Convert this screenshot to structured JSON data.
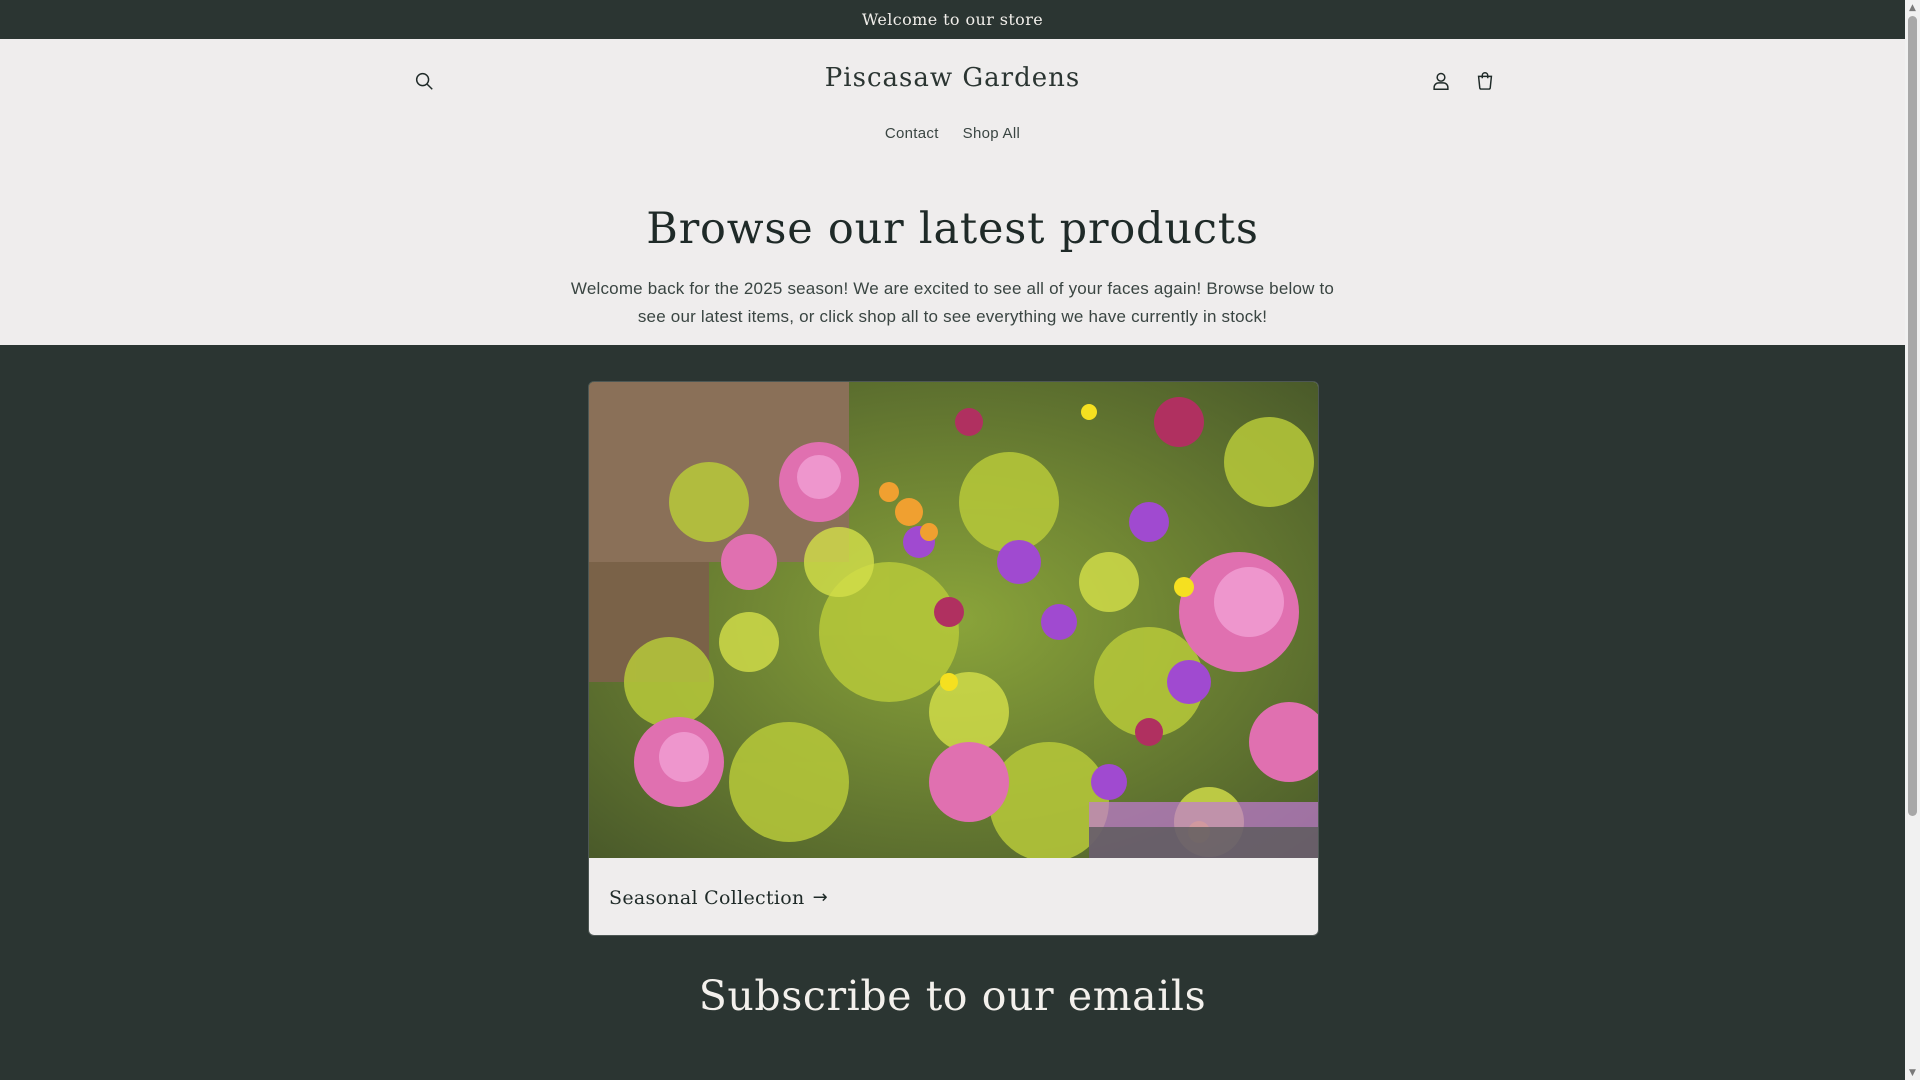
{
  "announcement": {
    "text": "Welcome to our store"
  },
  "header": {
    "brand": "Piscasaw Gardens",
    "icons": {
      "search": "search-icon",
      "account": "account-icon",
      "cart": "cart-icon"
    }
  },
  "nav": {
    "items": [
      {
        "label": "Contact"
      },
      {
        "label": "Shop All"
      }
    ]
  },
  "hero": {
    "title": "Browse our latest products",
    "text": "Welcome back for the 2025 season! We are excited to see all of your faces again! Browse below to see our latest items, or click shop all to see everything we have currently in stock!"
  },
  "collection": {
    "title": "Seasonal Collection",
    "arrow": "→",
    "image_alt": "Bouquets of mixed flowers: pink peonies, purple stock, yellow and green filler"
  },
  "subscribe": {
    "title": "Subscribe to our emails"
  },
  "colors": {
    "dark": "#2b3532",
    "light": "#efeded",
    "text": "#1f2a28"
  }
}
